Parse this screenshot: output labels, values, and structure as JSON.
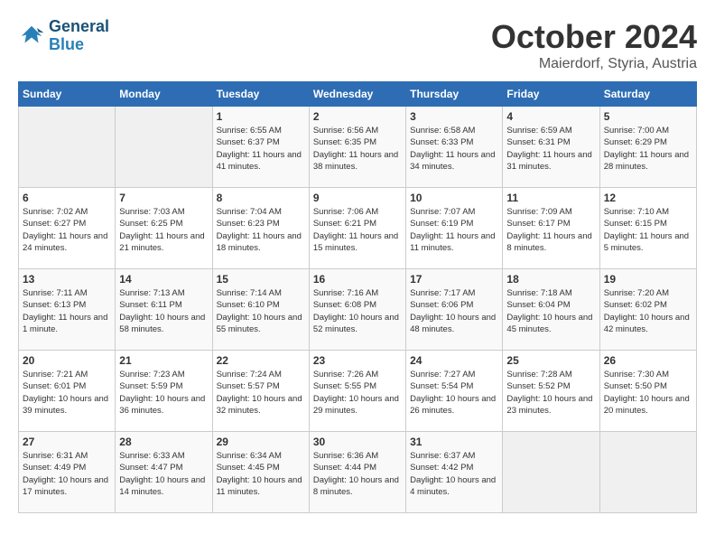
{
  "logo": {
    "line1": "General",
    "line2": "Blue"
  },
  "title": "October 2024",
  "location": "Maierdorf, Styria, Austria",
  "weekdays": [
    "Sunday",
    "Monday",
    "Tuesday",
    "Wednesday",
    "Thursday",
    "Friday",
    "Saturday"
  ],
  "weeks": [
    [
      {
        "day": "",
        "info": ""
      },
      {
        "day": "",
        "info": ""
      },
      {
        "day": "1",
        "info": "Sunrise: 6:55 AM\nSunset: 6:37 PM\nDaylight: 11 hours and 41 minutes."
      },
      {
        "day": "2",
        "info": "Sunrise: 6:56 AM\nSunset: 6:35 PM\nDaylight: 11 hours and 38 minutes."
      },
      {
        "day": "3",
        "info": "Sunrise: 6:58 AM\nSunset: 6:33 PM\nDaylight: 11 hours and 34 minutes."
      },
      {
        "day": "4",
        "info": "Sunrise: 6:59 AM\nSunset: 6:31 PM\nDaylight: 11 hours and 31 minutes."
      },
      {
        "day": "5",
        "info": "Sunrise: 7:00 AM\nSunset: 6:29 PM\nDaylight: 11 hours and 28 minutes."
      }
    ],
    [
      {
        "day": "6",
        "info": "Sunrise: 7:02 AM\nSunset: 6:27 PM\nDaylight: 11 hours and 24 minutes."
      },
      {
        "day": "7",
        "info": "Sunrise: 7:03 AM\nSunset: 6:25 PM\nDaylight: 11 hours and 21 minutes."
      },
      {
        "day": "8",
        "info": "Sunrise: 7:04 AM\nSunset: 6:23 PM\nDaylight: 11 hours and 18 minutes."
      },
      {
        "day": "9",
        "info": "Sunrise: 7:06 AM\nSunset: 6:21 PM\nDaylight: 11 hours and 15 minutes."
      },
      {
        "day": "10",
        "info": "Sunrise: 7:07 AM\nSunset: 6:19 PM\nDaylight: 11 hours and 11 minutes."
      },
      {
        "day": "11",
        "info": "Sunrise: 7:09 AM\nSunset: 6:17 PM\nDaylight: 11 hours and 8 minutes."
      },
      {
        "day": "12",
        "info": "Sunrise: 7:10 AM\nSunset: 6:15 PM\nDaylight: 11 hours and 5 minutes."
      }
    ],
    [
      {
        "day": "13",
        "info": "Sunrise: 7:11 AM\nSunset: 6:13 PM\nDaylight: 11 hours and 1 minute."
      },
      {
        "day": "14",
        "info": "Sunrise: 7:13 AM\nSunset: 6:11 PM\nDaylight: 10 hours and 58 minutes."
      },
      {
        "day": "15",
        "info": "Sunrise: 7:14 AM\nSunset: 6:10 PM\nDaylight: 10 hours and 55 minutes."
      },
      {
        "day": "16",
        "info": "Sunrise: 7:16 AM\nSunset: 6:08 PM\nDaylight: 10 hours and 52 minutes."
      },
      {
        "day": "17",
        "info": "Sunrise: 7:17 AM\nSunset: 6:06 PM\nDaylight: 10 hours and 48 minutes."
      },
      {
        "day": "18",
        "info": "Sunrise: 7:18 AM\nSunset: 6:04 PM\nDaylight: 10 hours and 45 minutes."
      },
      {
        "day": "19",
        "info": "Sunrise: 7:20 AM\nSunset: 6:02 PM\nDaylight: 10 hours and 42 minutes."
      }
    ],
    [
      {
        "day": "20",
        "info": "Sunrise: 7:21 AM\nSunset: 6:01 PM\nDaylight: 10 hours and 39 minutes."
      },
      {
        "day": "21",
        "info": "Sunrise: 7:23 AM\nSunset: 5:59 PM\nDaylight: 10 hours and 36 minutes."
      },
      {
        "day": "22",
        "info": "Sunrise: 7:24 AM\nSunset: 5:57 PM\nDaylight: 10 hours and 32 minutes."
      },
      {
        "day": "23",
        "info": "Sunrise: 7:26 AM\nSunset: 5:55 PM\nDaylight: 10 hours and 29 minutes."
      },
      {
        "day": "24",
        "info": "Sunrise: 7:27 AM\nSunset: 5:54 PM\nDaylight: 10 hours and 26 minutes."
      },
      {
        "day": "25",
        "info": "Sunrise: 7:28 AM\nSunset: 5:52 PM\nDaylight: 10 hours and 23 minutes."
      },
      {
        "day": "26",
        "info": "Sunrise: 7:30 AM\nSunset: 5:50 PM\nDaylight: 10 hours and 20 minutes."
      }
    ],
    [
      {
        "day": "27",
        "info": "Sunrise: 6:31 AM\nSunset: 4:49 PM\nDaylight: 10 hours and 17 minutes."
      },
      {
        "day": "28",
        "info": "Sunrise: 6:33 AM\nSunset: 4:47 PM\nDaylight: 10 hours and 14 minutes."
      },
      {
        "day": "29",
        "info": "Sunrise: 6:34 AM\nSunset: 4:45 PM\nDaylight: 10 hours and 11 minutes."
      },
      {
        "day": "30",
        "info": "Sunrise: 6:36 AM\nSunset: 4:44 PM\nDaylight: 10 hours and 8 minutes."
      },
      {
        "day": "31",
        "info": "Sunrise: 6:37 AM\nSunset: 4:42 PM\nDaylight: 10 hours and 4 minutes."
      },
      {
        "day": "",
        "info": ""
      },
      {
        "day": "",
        "info": ""
      }
    ]
  ]
}
